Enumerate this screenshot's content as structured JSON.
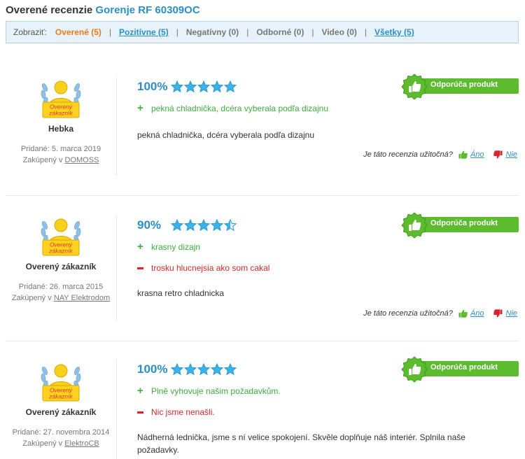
{
  "page": {
    "heading_prefix": "Overené recenzie",
    "product_name": "Gorenje RF 60309OC"
  },
  "filters": {
    "label": "Zobraziť:",
    "items": [
      {
        "label": "Overené (5)"
      },
      {
        "label": "Pozitívne (5)"
      },
      {
        "label": "Negatívny (0)"
      },
      {
        "label": "Odborné (0)"
      },
      {
        "label": "Video (0)"
      },
      {
        "label": "Všetky (5)"
      }
    ]
  },
  "badge_text": [
    "Overený",
    "zákazník"
  ],
  "colors": {
    "accent_blue": "#2b8fc7",
    "active_orange": "#f07a1e",
    "pro_green": "#3cae3c",
    "con_red": "#d9262c",
    "recommend_green": "#5dbb2f"
  },
  "reviews": [
    {
      "user_name": "Hebka",
      "added": "Pridané: 5. marca 2019",
      "bought_prefix": "Zakúpený v",
      "shop": "DOMOSS",
      "percent": "100%",
      "stars": 5,
      "pros": [
        "pekná chladnička, dcéra vyberala podľa dizajnu"
      ],
      "cons": [],
      "text": "pekná chladnička, dcéra vyberala podľa dizajnu",
      "recommend": "Odporúča produkt"
    },
    {
      "user_name": "Overený zákazník",
      "added": "Pridané: 26. marca 2015",
      "bought_prefix": "Zakúpený v",
      "shop": "NAY Elektrodom",
      "percent": "90%",
      "stars": 4.5,
      "pros": [
        "krasny dizajn"
      ],
      "cons": [
        "trosku hlucnejsia ako som cakal"
      ],
      "text": "krasna retro chladnicka",
      "recommend": "Odporúča produkt"
    },
    {
      "user_name": "Overený zákazník",
      "added": "Pridané: 27. novembra 2014",
      "bought_prefix": "Zakúpený v",
      "shop": "ElektroCB",
      "percent": "100%",
      "stars": 5,
      "pros": [
        "Plně vyhovuje našim požadavkům."
      ],
      "cons": [
        "Nic jsme nenašli."
      ],
      "text": "Nádherná lednička, jsme s ní velice spokojení. Skvěle doplňuje náš interiér. Splnila naše požadavky.",
      "recommend": "Odporúča produkt"
    }
  ],
  "usefulness": {
    "question": "Je táto recenzia užitočná?",
    "yes": "Áno",
    "no": "Nie"
  }
}
